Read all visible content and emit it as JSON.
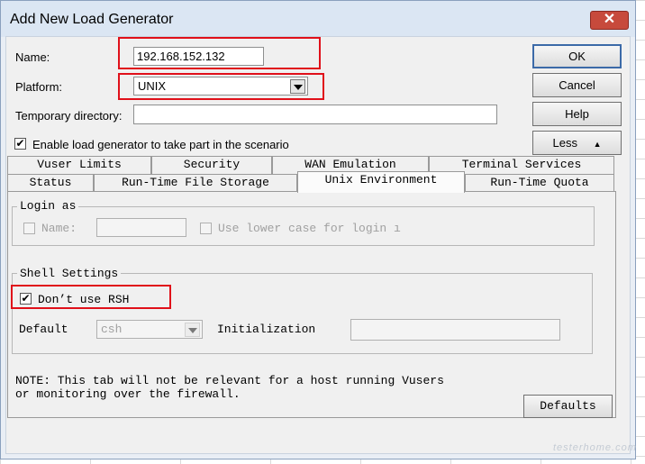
{
  "window": {
    "title": "Add New Load Generator",
    "close_glyph": "✕"
  },
  "fields": {
    "name_label": "Name:",
    "name_value": "192.168.152.132",
    "platform_label": "Platform:",
    "platform_value": "UNIX",
    "tempdir_label": "Temporary directory:",
    "tempdir_value": "",
    "enable_label": "Enable load generator to take part in the scenario",
    "enable_checked": "✔"
  },
  "buttons": {
    "ok": "OK",
    "cancel": "Cancel",
    "help": "Help",
    "less": "Less",
    "less_arrow": "▲",
    "defaults": "Defaults"
  },
  "tabs_row1": [
    "Vuser Limits",
    "Security",
    "WAN Emulation",
    "Terminal Services"
  ],
  "tabs_row2": [
    "Status",
    "Run-Time File Storage",
    "Unix Environment",
    "Run-Time Quota"
  ],
  "active_tab": "Unix Environment",
  "login": {
    "group_title": "Login as",
    "name_label": "Name:",
    "name_value": "",
    "lowercase_label": "Use lower case for login ı"
  },
  "shell": {
    "group_title": "Shell Settings",
    "dont_use_rsh_label": "Don’t use RSH",
    "dont_use_rsh_checked": "✔",
    "default_label": "Default",
    "default_value": "csh",
    "init_label": "Initialization",
    "init_value": ""
  },
  "note": {
    "line1": "NOTE: This tab will not be relevant for a host running Vusers",
    "line2": "or monitoring over the firewall."
  },
  "watermark": "testerhome.com",
  "colors": {
    "highlight_box": "#e0101a",
    "close_button": "#c74a3c",
    "titlebar": "#dbe6f3"
  }
}
